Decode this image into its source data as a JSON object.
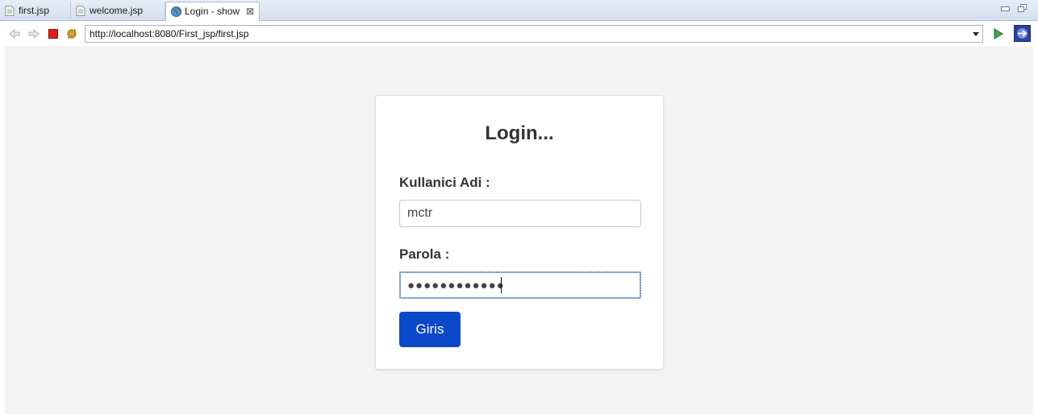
{
  "tabs": [
    {
      "label": "first.jsp",
      "icon": "file-icon"
    },
    {
      "label": "welcome.jsp",
      "icon": "file-icon"
    },
    {
      "label": "Login - show",
      "icon": "globe-icon",
      "active": true
    }
  ],
  "toolbar": {
    "url": "http://localhost:8080/First_jsp/first.jsp"
  },
  "form": {
    "title": "Login...",
    "username_label": "Kullanici Adi :",
    "username_value": "mctr",
    "password_label": "Parola :",
    "password_value": "●●●●●●●●●●●●",
    "submit_label": "Giris"
  },
  "colors": {
    "button": "#0b48c8",
    "page_background": "#f4f4f4",
    "card_background": "#ffffff",
    "text": "#333333"
  }
}
